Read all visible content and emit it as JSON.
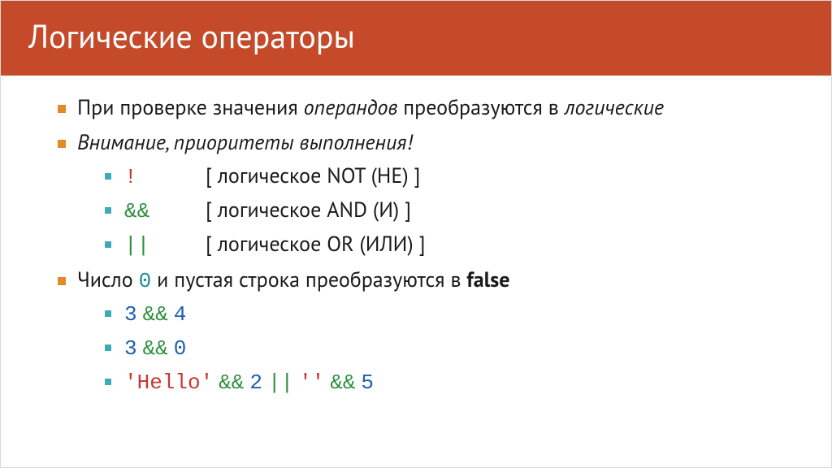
{
  "title": "Логические операторы",
  "bullets": {
    "b1_pre": "При проверке значения ",
    "b1_it1": "операндов",
    "b1_mid": " преобразуются в ",
    "b1_it2": "логические",
    "b2": "Внимание, приоритеты выполнения!",
    "ops": [
      {
        "sym": "!",
        "desc": "[ логическое NOT (НЕ) ]"
      },
      {
        "sym": "&&",
        "desc": "[ логическое AND (И) ]"
      },
      {
        "sym": "||",
        "desc": "[ логическое OR (ИЛИ) ]"
      }
    ],
    "b3_pre": "Число ",
    "b3_zero": "0",
    "b3_mid": " и пустая строка преобразуются в ",
    "b3_false": "false",
    "ex1": {
      "a": "3",
      "op": "&&",
      "b": "4"
    },
    "ex2": {
      "a": "3",
      "op": "&&",
      "b": "0"
    },
    "ex3": {
      "s": "'Hello'",
      "op1": "&&",
      "n1": "2",
      "op2": "||",
      "s2": "''",
      "op3": "&&",
      "n2": "5"
    }
  }
}
